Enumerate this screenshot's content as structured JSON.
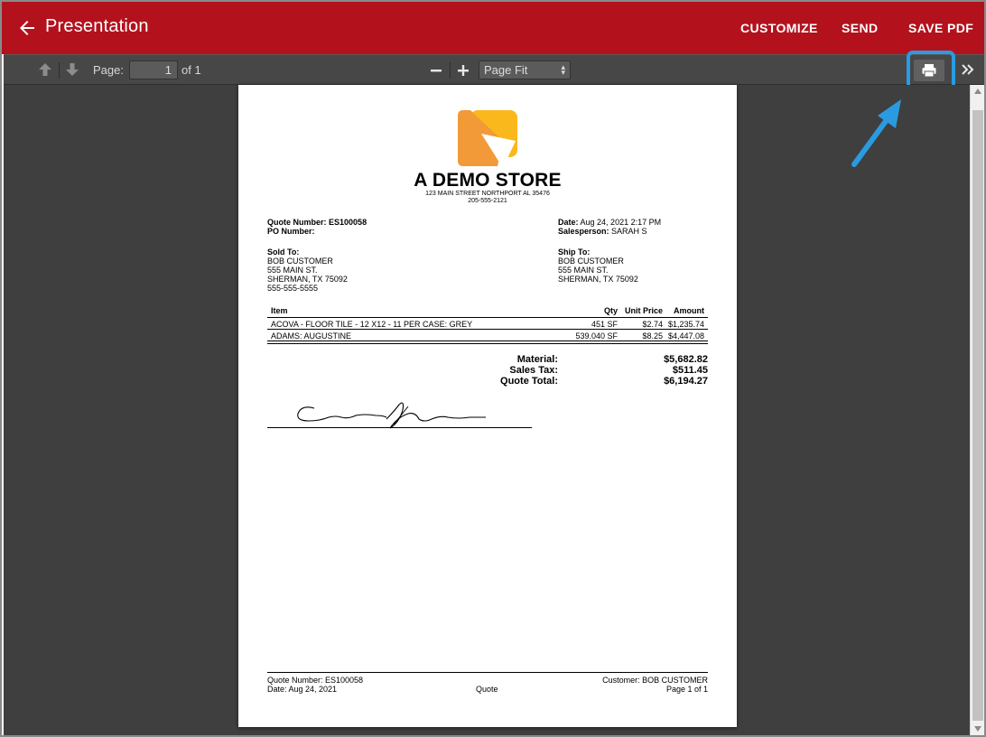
{
  "appbar": {
    "title": "Presentation",
    "actions": {
      "customize": "CUSTOMIZE",
      "send": "SEND",
      "save_pdf": "SAVE PDF"
    }
  },
  "toolbar": {
    "page_label": "Page:",
    "page_value": "1",
    "page_of": "of 1",
    "zoom_value": "Page Fit"
  },
  "document": {
    "store_name": "A DEMO STORE",
    "store_address": "123 MAIN STREET NORTHPORT AL 35476",
    "store_phone": "205-555-2121",
    "quote_number_label": "Quote Number:",
    "quote_number": "ES100058",
    "po_number_label": "PO Number:",
    "date_label": "Date:",
    "date": "Aug 24, 2021 2:17 PM",
    "salesperson_label": "Salesperson:",
    "salesperson": "SARAH S",
    "sold_to": {
      "label": "Sold To:",
      "lines": [
        "BOB CUSTOMER",
        "555 MAIN ST.",
        "SHERMAN, TX 75092",
        "555-555-5555"
      ]
    },
    "ship_to": {
      "label": "Ship To:",
      "lines": [
        "BOB CUSTOMER",
        "555 MAIN ST.",
        "SHERMAN, TX 75092"
      ]
    },
    "table": {
      "headers": {
        "item": "Item",
        "qty": "Qty",
        "unit_price": "Unit Price",
        "amount": "Amount"
      },
      "rows": [
        {
          "item": "ACOVA - FLOOR TILE - 12 X12 - 11 PER CASE: GREY",
          "qty": "451 SF",
          "unit_price": "$2.74",
          "amount": "$1,235.74"
        },
        {
          "item": "ADAMS: AUGUSTINE",
          "qty": "539.040 SF",
          "unit_price": "$8.25",
          "amount": "$4,447.08"
        }
      ]
    },
    "totals": {
      "material_label": "Material:",
      "material": "$5,682.82",
      "tax_label": "Sales Tax:",
      "tax": "$511.45",
      "total_label": "Quote Total:",
      "total": "$6,194.27"
    },
    "footer": {
      "quote_number": "Quote Number: ES100058",
      "date": "Date: Aug 24, 2021",
      "center": "Quote",
      "customer": "Customer: BOB CUSTOMER",
      "page": "Page 1 of 1"
    }
  },
  "colors": {
    "appbar": "#b3121d",
    "highlight": "#2a9be0",
    "logo_orange": "#f29a38",
    "logo_yellow": "#fbb81c"
  },
  "icons": {
    "back": "arrow-left-icon",
    "prev_page": "arrow-up-icon",
    "next_page": "arrow-down-icon",
    "zoom_out": "minus-icon",
    "zoom_in": "plus-icon",
    "print": "printer-icon",
    "more": "double-chevron-right-icon"
  }
}
